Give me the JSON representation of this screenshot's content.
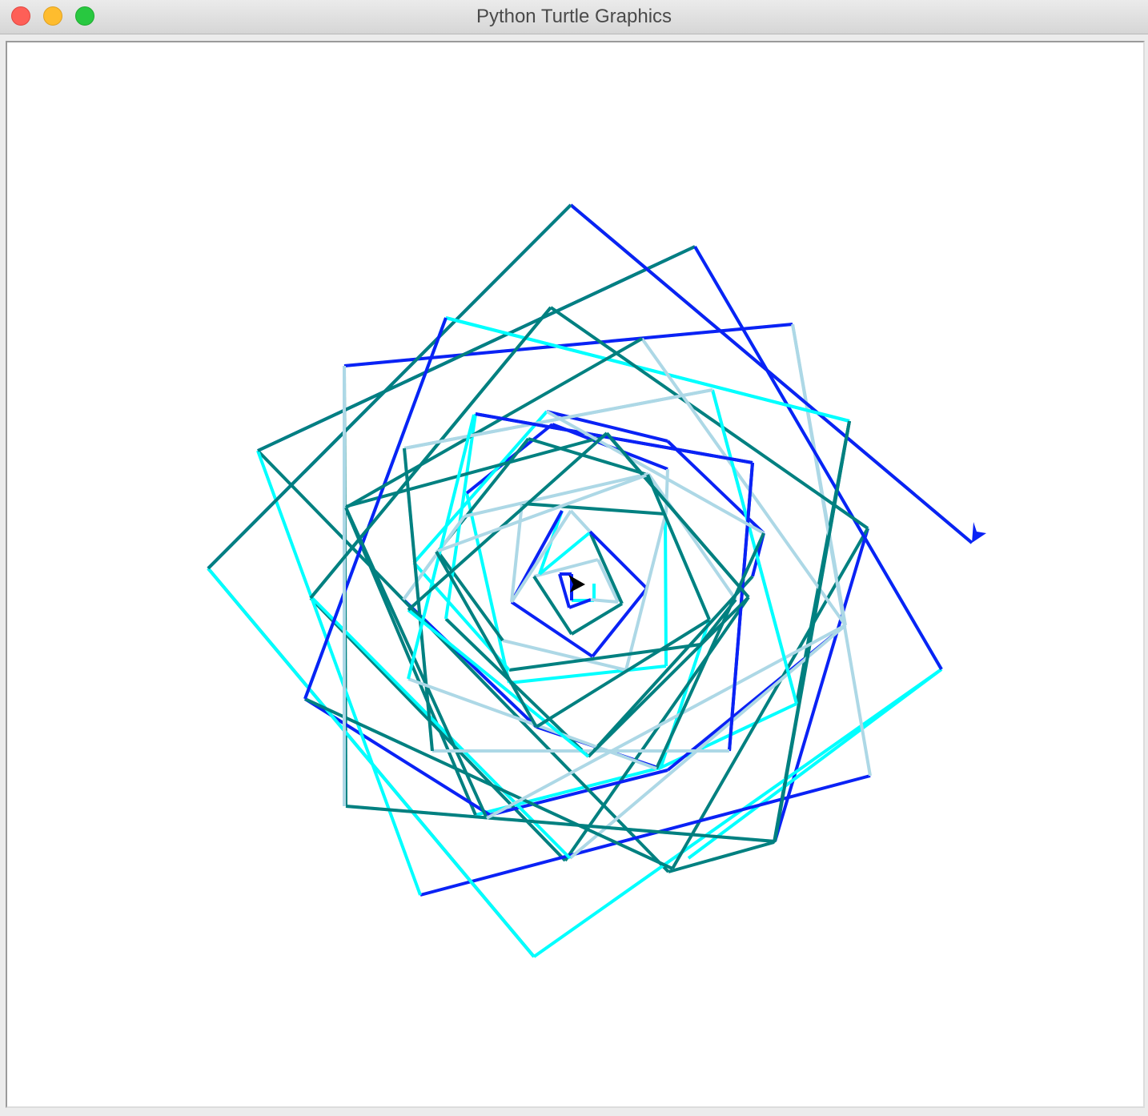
{
  "window": {
    "title": "Python Turtle Graphics"
  },
  "drawing": {
    "description_colors": {
      "teal": "#008080",
      "blue": "#0a22f5",
      "cyan": "#00ffff",
      "lightblue": "#add8e6"
    },
    "turtle_color": "#000000",
    "turtle_shape": "classic-arrow"
  }
}
